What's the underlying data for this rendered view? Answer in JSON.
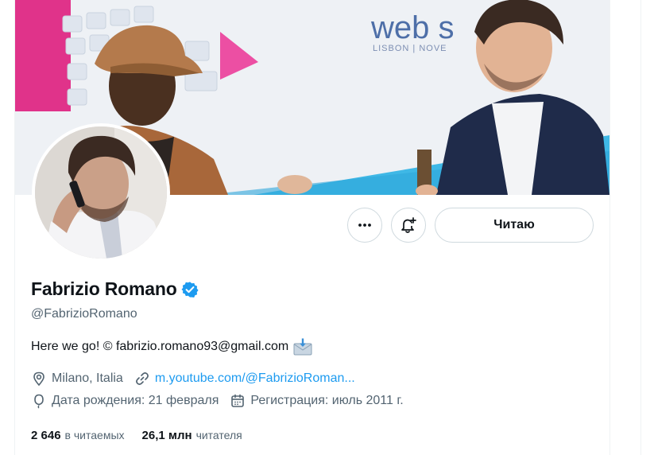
{
  "profile": {
    "display_name": "Fabrizio Romano",
    "handle": "@FabrizioRomano",
    "bio": "Here we go! © fabrizio.romano93@gmail.com",
    "location": "Milano, Italia",
    "website": "m.youtube.com/@FabrizioRoman...",
    "birthday": "Дата рождения: 21 февраля",
    "joined": "Регистрация: июль 2011 г."
  },
  "actions": {
    "more_icon": "more-horizontal-icon",
    "notify_icon": "bell-plus-icon",
    "follow_label": "Читаю"
  },
  "stats": {
    "following_count": "2 646",
    "following_label": "в читаемых",
    "followers_count": "26,1 млн",
    "followers_label": "читателя"
  },
  "banner": {
    "sign_text": "web s",
    "sign_sub": "LISBON | NOVE"
  },
  "colors": {
    "accent": "#1d9bf0",
    "text": "#0f1419",
    "secondary": "#536471",
    "border": "#cfd9de"
  }
}
